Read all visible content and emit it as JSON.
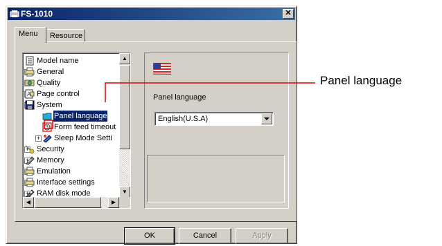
{
  "window": {
    "title": "FS-1010",
    "close_glyph": "✕"
  },
  "tabs": [
    {
      "label": "Menu",
      "active": true
    },
    {
      "label": "Resource",
      "active": false
    }
  ],
  "tree": {
    "items": [
      {
        "label": "Model name",
        "expander": "",
        "icon": "document-icon"
      },
      {
        "label": "General",
        "expander": "+",
        "icon": "printer-icon"
      },
      {
        "label": "Quality",
        "expander": "+",
        "icon": "quality-icon"
      },
      {
        "label": "Page control",
        "expander": "+",
        "icon": "page-control-icon"
      },
      {
        "label": "System",
        "expander": "−",
        "icon": "floppy-disk-icon"
      },
      {
        "label": "Panel language",
        "expander": "",
        "icon": "folder-icon",
        "selected": true
      },
      {
        "label": "Form feed timeout",
        "expander": "",
        "icon": "clock-icon"
      },
      {
        "label": "Sleep Mode Setti",
        "expander": "+",
        "icon": "sleep-mode-icon"
      },
      {
        "label": "Security",
        "expander": "+",
        "icon": "key-icon"
      },
      {
        "label": "Memory",
        "expander": "+",
        "icon": "memory-icon"
      },
      {
        "label": "Emulation",
        "expander": "+",
        "icon": "printer-icon"
      },
      {
        "label": "Interface settings",
        "expander": "+",
        "icon": "printer-icon"
      },
      {
        "label": "RAM disk mode",
        "expander": "+",
        "icon": "ram-disk-icon"
      }
    ]
  },
  "right_panel": {
    "field_label": "Panel language",
    "selected_value": "English(U.S.A)",
    "flag_icon": "us-flag-icon"
  },
  "buttons": {
    "ok": "OK",
    "cancel": "Cancel",
    "apply": "Apply"
  },
  "callout": {
    "label": "Panel language",
    "color": "#e00000"
  },
  "colors": {
    "titlebar": "#0a246a",
    "selection": "#0a246a",
    "face": "#d4d0c8"
  }
}
